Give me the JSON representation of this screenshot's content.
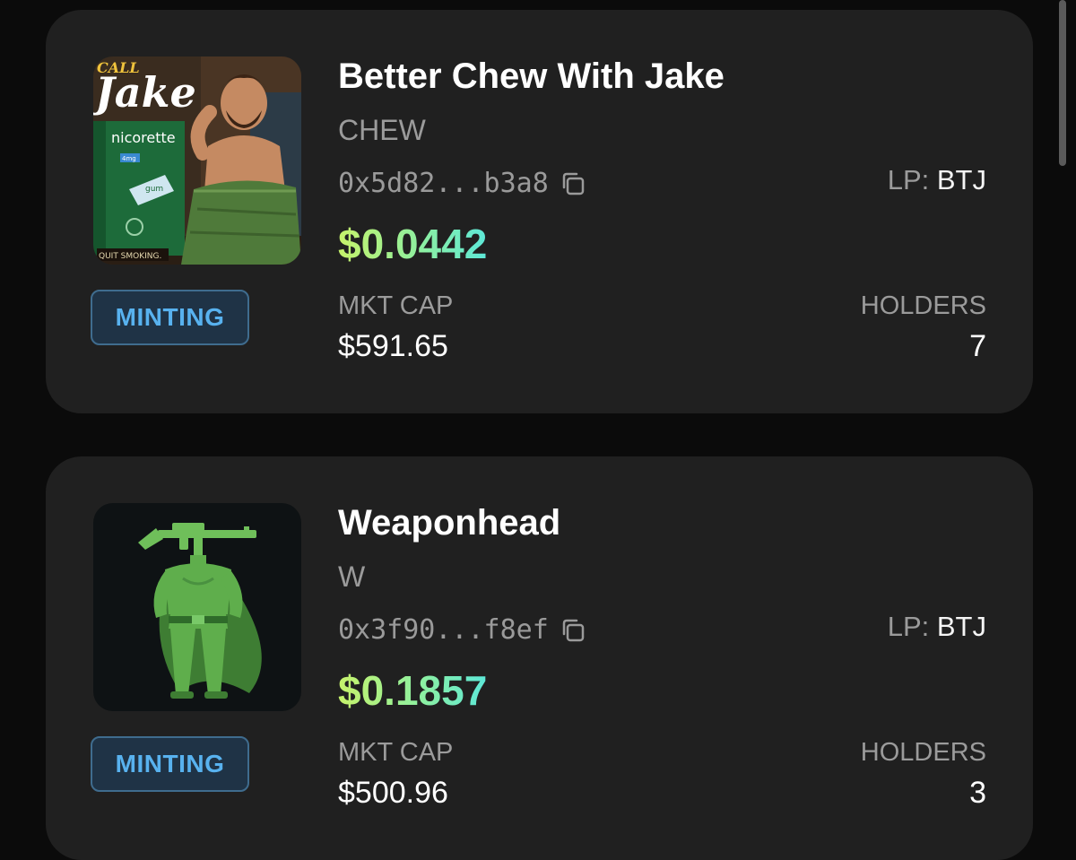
{
  "tokens": [
    {
      "name": "Better Chew With Jake",
      "ticker": "CHEW",
      "address": "0x5d82...b3a8",
      "lp_label": "LP:",
      "lp_value": "BTJ",
      "price": "$0.0442",
      "status": "MINTING",
      "mkt_cap_label": "MKT CAP",
      "mkt_cap": "$591.65",
      "holders_label": "HOLDERS",
      "holders": "7",
      "image": {
        "brand_text": "Jake",
        "banner_text": "CALL",
        "product_text": "nicorette",
        "dose_text": "4mg",
        "flavor_text": "gum",
        "footer_text": "QUIT SMOKING."
      }
    },
    {
      "name": "Weaponhead",
      "ticker": "W",
      "address": "0x3f90...f8ef",
      "lp_label": "LP:",
      "lp_value": "BTJ",
      "price": "$0.1857",
      "status": "MINTING",
      "mkt_cap_label": "MKT CAP",
      "mkt_cap": "$500.96",
      "holders_label": "HOLDERS",
      "holders": "3"
    }
  ],
  "colors": {
    "card_bg": "#202020",
    "badge_text": "#58b2ef",
    "price_gradient_start": "#c6f26b",
    "price_gradient_end": "#5de8d8"
  }
}
